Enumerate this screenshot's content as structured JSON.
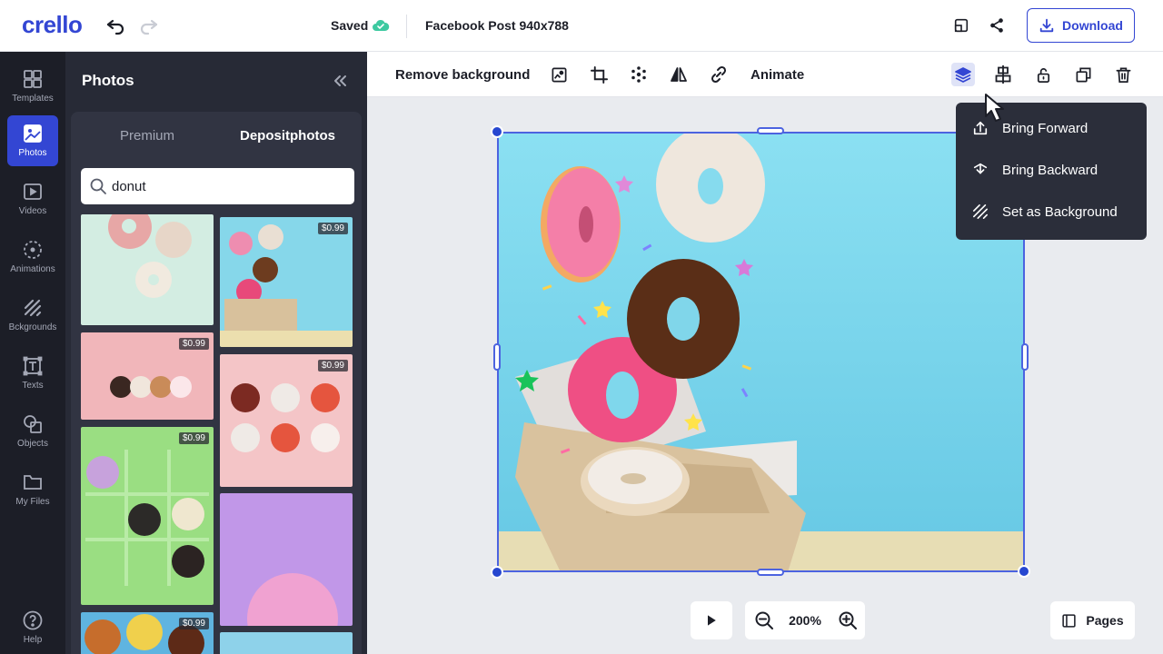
{
  "app": {
    "logo": "crello"
  },
  "topbar": {
    "saved": "Saved",
    "doc_title": "Facebook Post 940x788",
    "download": "Download"
  },
  "leftnav": {
    "items": [
      {
        "label": "Templates",
        "icon": "templates-icon"
      },
      {
        "label": "Photos",
        "icon": "photos-icon",
        "active": true
      },
      {
        "label": "Videos",
        "icon": "videos-icon"
      },
      {
        "label": "Animations",
        "icon": "animations-icon"
      },
      {
        "label": "Bckgrounds",
        "icon": "backgrounds-icon"
      },
      {
        "label": "Texts",
        "icon": "texts-icon"
      },
      {
        "label": "Objects",
        "icon": "objects-icon"
      },
      {
        "label": "My Files",
        "icon": "folder-icon"
      }
    ],
    "help": "Help"
  },
  "panel": {
    "title": "Photos",
    "tabs": [
      "Premium",
      "Depositphotos"
    ],
    "active_tab": "Depositphotos",
    "search_value": "donut",
    "prices": [
      "$0.99",
      "$0.99",
      "$0.99",
      "$0.99",
      "$0.99"
    ]
  },
  "toolbar": {
    "remove_bg": "Remove background",
    "animate": "Animate"
  },
  "menu": {
    "items": [
      "Bring Forward",
      "Bring Backward",
      "Set as Background"
    ]
  },
  "zoom": {
    "value": "200%"
  },
  "pages": {
    "label": "Pages"
  },
  "colors": {
    "accent": "#3346d3",
    "nav_bg": "#1c1e27",
    "panel_bg": "#272a36",
    "canvas_bg": "#e9ebef",
    "sky": "#7fd7ec"
  }
}
